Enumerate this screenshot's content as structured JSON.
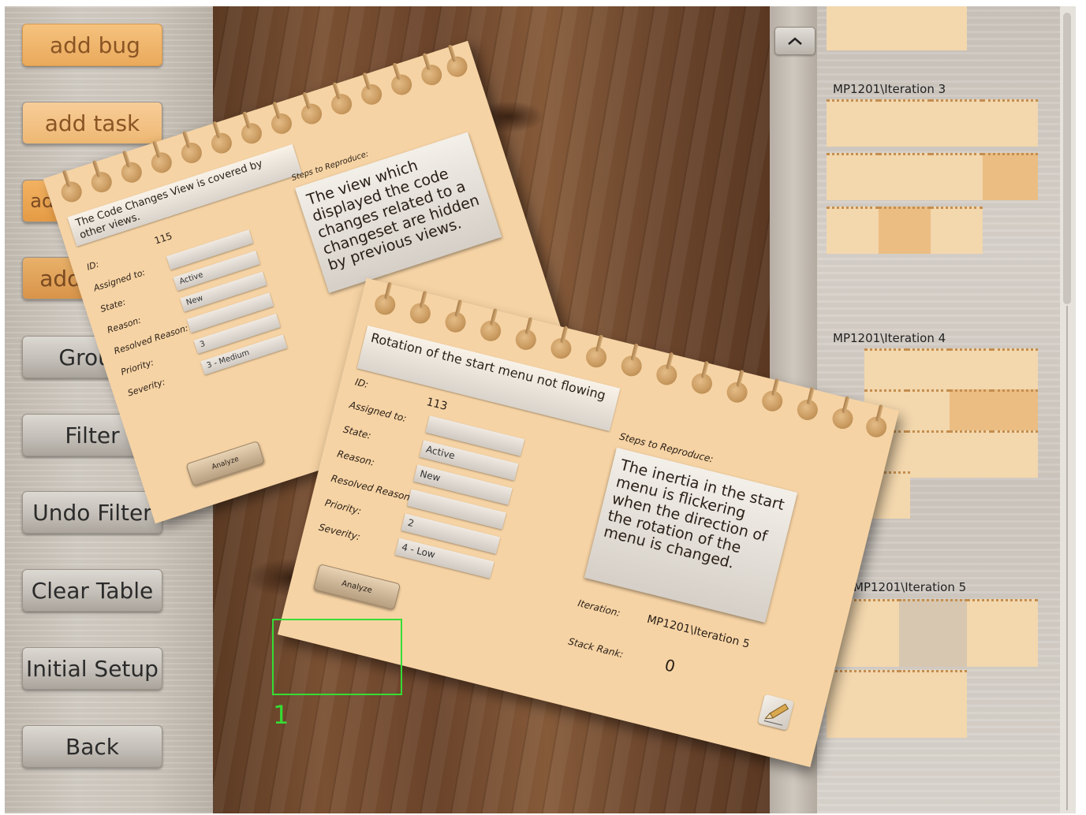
{
  "sidebar": {
    "buttons": [
      {
        "label": "add bug"
      },
      {
        "label": "add task"
      },
      {
        "label": "add user story"
      },
      {
        "label": "add issue"
      },
      {
        "label": "Group"
      },
      {
        "label": "Filter"
      },
      {
        "label": "Undo Filter"
      },
      {
        "label": "Clear Table"
      },
      {
        "label": "Initial Setup"
      },
      {
        "label": "Back"
      }
    ]
  },
  "back_card": {
    "title": "The Code Changes View is covered by other views.",
    "id_label": "ID:",
    "id_value": "115",
    "assigned_label": "Assigned to:",
    "assigned_value": "",
    "state_label": "State:",
    "state_value": "Active",
    "reason_label": "Reason:",
    "reason_value": "New",
    "resolved_label": "Resolved Reason:",
    "resolved_value": "",
    "priority_label": "Priority:",
    "priority_value": "3",
    "severity_label": "Severity:",
    "severity_value": "3 - Medium",
    "steps_label": "Steps to Reproduce:",
    "steps_text": "The view which displayed the code changes related to a changeset are hidden by previous views.",
    "analyze_label": "Analyze"
  },
  "front_card": {
    "title": "Rotation of the start menu not flowing",
    "id_label": "ID:",
    "id_value": "113",
    "assigned_label": "Assigned to:",
    "assigned_value": "",
    "state_label": "State:",
    "state_value": "Active",
    "reason_label": "Reason:",
    "reason_value": "New",
    "resolved_label": "Resolved Reason:",
    "resolved_value": "",
    "priority_label": "Priority:",
    "priority_value": "2",
    "severity_label": "Severity:",
    "severity_value": "4 - Low",
    "steps_label": "Steps to Reproduce:",
    "steps_text": "The inertia in the start menu is flickering when the direction of the rotation of the menu is changed.",
    "iteration_label": "Iteration:",
    "iteration_value": "MP1201\\Iteration 5",
    "stack_rank_label": "Stack Rank:",
    "stack_rank_value": "0",
    "analyze_label": "Analyze"
  },
  "overview": {
    "iterations": [
      {
        "title": "MP1201\\Iteration 3"
      },
      {
        "title": "MP1201\\Iteration 4"
      },
      {
        "title": "MP1201\\Iteration 5"
      }
    ]
  },
  "annotation": {
    "number": "1"
  },
  "colors": {
    "card": "#f6d3a4",
    "highlight": "#35dd35",
    "accent_orange": "#eaaa5c"
  }
}
